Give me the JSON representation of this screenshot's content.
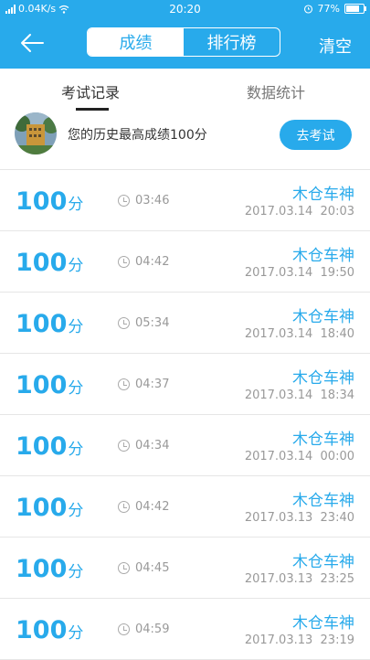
{
  "status": {
    "speed": "0.04K/s",
    "time": "20:20",
    "battery_percent": "77%",
    "battery_level": 0.77
  },
  "header": {
    "back_icon": "arrow-left-icon",
    "tabs": [
      {
        "label": "成绩",
        "active": true
      },
      {
        "label": "排行榜",
        "active": false
      }
    ],
    "clear_label": "清空"
  },
  "subtabs": [
    {
      "label": "考试记录",
      "active": true
    },
    {
      "label": "数据统计",
      "active": false
    }
  ],
  "profile": {
    "text": "您的历史最高成绩100分",
    "button_label": "去考试"
  },
  "records": [
    {
      "score": "100",
      "unit": "分",
      "duration": "03:46",
      "name": "木仓车神",
      "date": "2017.03.14",
      "time": "20:03"
    },
    {
      "score": "100",
      "unit": "分",
      "duration": "04:42",
      "name": "木仓车神",
      "date": "2017.03.14",
      "time": "19:50"
    },
    {
      "score": "100",
      "unit": "分",
      "duration": "05:34",
      "name": "木仓车神",
      "date": "2017.03.14",
      "time": "18:40"
    },
    {
      "score": "100",
      "unit": "分",
      "duration": "04:37",
      "name": "木仓车神",
      "date": "2017.03.14",
      "time": "18:34"
    },
    {
      "score": "100",
      "unit": "分",
      "duration": "04:34",
      "name": "木仓车神",
      "date": "2017.03.14",
      "time": "00:00"
    },
    {
      "score": "100",
      "unit": "分",
      "duration": "04:42",
      "name": "木仓车神",
      "date": "2017.03.13",
      "time": "23:40"
    },
    {
      "score": "100",
      "unit": "分",
      "duration": "04:45",
      "name": "木仓车神",
      "date": "2017.03.13",
      "time": "23:25"
    },
    {
      "score": "100",
      "unit": "分",
      "duration": "04:59",
      "name": "木仓车神",
      "date": "2017.03.13",
      "time": "23:19"
    }
  ],
  "colors": {
    "accent": "#28aaeb",
    "muted_text": "#999999"
  }
}
